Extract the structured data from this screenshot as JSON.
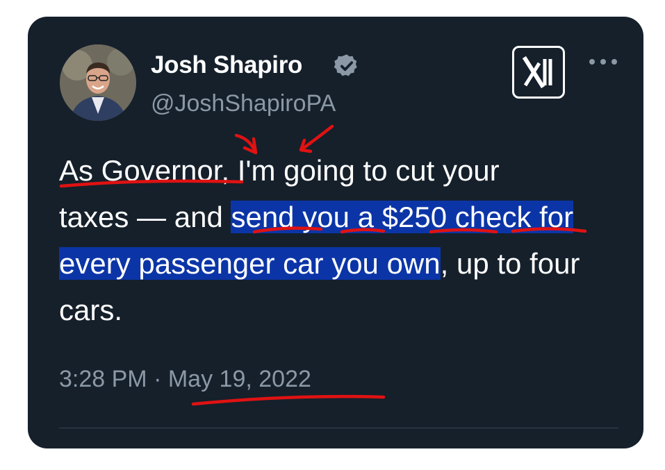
{
  "tweet": {
    "author": {
      "display_name": "Josh Shapiro",
      "handle": "@JoshShapiroPA",
      "verified_icon": "verified-badge-icon"
    },
    "brand_icon": "x-logo-icon",
    "more_icon": "more-options-icon",
    "text": {
      "part1": "As Governor, I'm going to cut your",
      "part2": "taxes — and ",
      "highlight": "send you a $250 check for every passenger car you own",
      "part3": ", up to four cars."
    },
    "time": "3:28 PM",
    "separator": "·",
    "date": "May 19, 2022"
  },
  "colors": {
    "card_background": "#15202b",
    "text": "#ffffff",
    "secondary_text": "#8b98a5",
    "highlight": "#0b35a7",
    "annotation_red": "#e01212",
    "verified_badge": "#8b98a5"
  },
  "annotations": {
    "underline_icon": "red-underline-marks",
    "arrow_icon": "red-arrow-marks"
  }
}
